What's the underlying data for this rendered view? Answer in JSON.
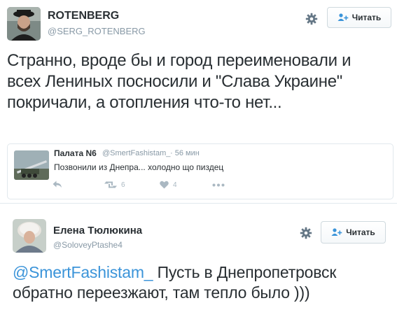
{
  "tweet1": {
    "display_name": "ROTENBERG",
    "handle": "@SERG_ROTENBERG",
    "follow_label": "Читать",
    "text": "Странно, вроде бы и город переименовали и всех Лениных посносили и \"Слава Украине\" покричали, а отопления что-то нет...",
    "quoted": {
      "display_name": "Палата N6",
      "handle": "@SmertFashistam_",
      "time": "· 56 мин",
      "text": "Позвонили из Днепра... холодно що пиздец",
      "retweets": "6",
      "likes": "4"
    }
  },
  "tweet2": {
    "display_name": "Елена Тюлюкина",
    "handle": "@SoloveyPtashe4",
    "follow_label": "Читать",
    "mention": "@SmertFashistam_",
    "text": " Пусть в Днепропетровск обратно переезжают, там тепло было )))"
  },
  "colors": {
    "link": "#3b94d9",
    "meta_gray": "#8899a6",
    "text": "#292f33",
    "border": "#e1e8ed"
  }
}
